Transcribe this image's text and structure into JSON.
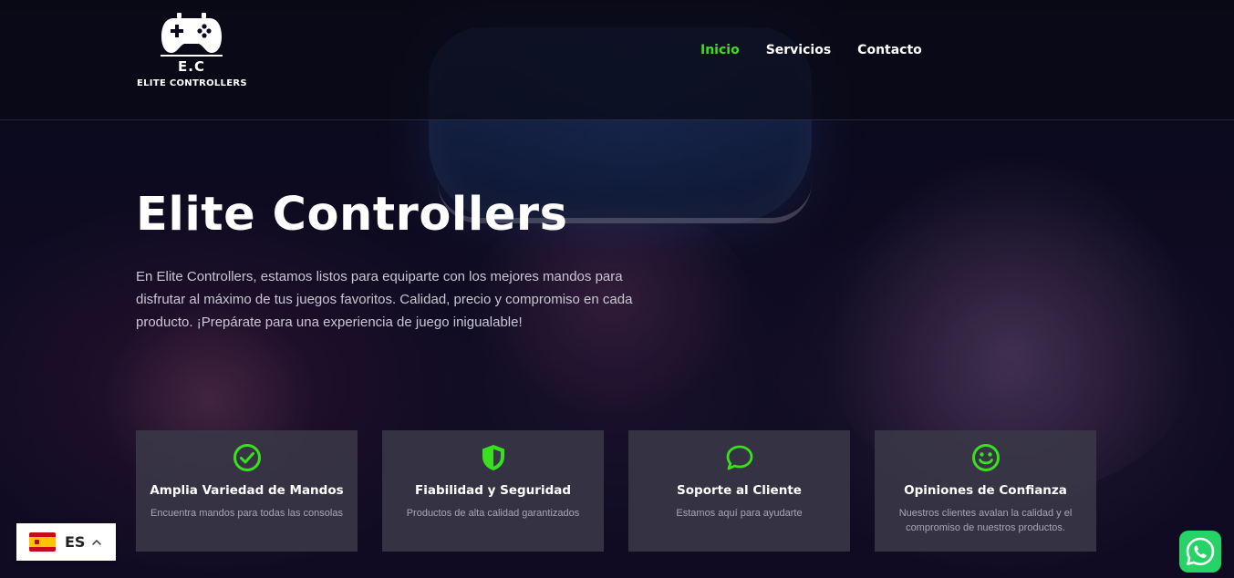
{
  "header": {
    "logo": {
      "icon": "gamepad-icon",
      "initials": "E.C",
      "name": "ELITE CONTROLLERS"
    },
    "nav": [
      {
        "label": "Inicio",
        "active": true
      },
      {
        "label": "Servicios",
        "active": false
      },
      {
        "label": "Contacto",
        "active": false
      }
    ]
  },
  "hero": {
    "title": "Elite Controllers",
    "text": "En Elite Controllers, estamos listos para equiparte con los mejores mandos para disfrutar al máximo de tus juegos favoritos. Calidad, precio y compromiso en cada producto. ¡Prepárate para una experiencia de juego inigualable!"
  },
  "features": [
    {
      "icon": "check-circle-icon",
      "title": "Amplia Variedad de Mandos",
      "desc": "Encuentra mandos para todas las consolas"
    },
    {
      "icon": "shield-icon",
      "title": "Fiabilidad y Seguridad",
      "desc": "Productos de alta calidad garantizados"
    },
    {
      "icon": "chat-bubble-icon",
      "title": "Soporte al Cliente",
      "desc": "Estamos aquí para ayudarte"
    },
    {
      "icon": "smiley-icon",
      "title": "Opiniones de Confianza",
      "desc": "Nuestros clientes avalan la calidad y el compromiso de nuestros productos."
    }
  ],
  "language_selector": {
    "code": "ES",
    "flag_icon": "spain-flag-icon"
  },
  "whatsapp": {
    "icon": "whatsapp-icon"
  },
  "colors": {
    "accent": "#39e01e",
    "card_bg": "#3a3848",
    "whatsapp": "#25d366"
  }
}
